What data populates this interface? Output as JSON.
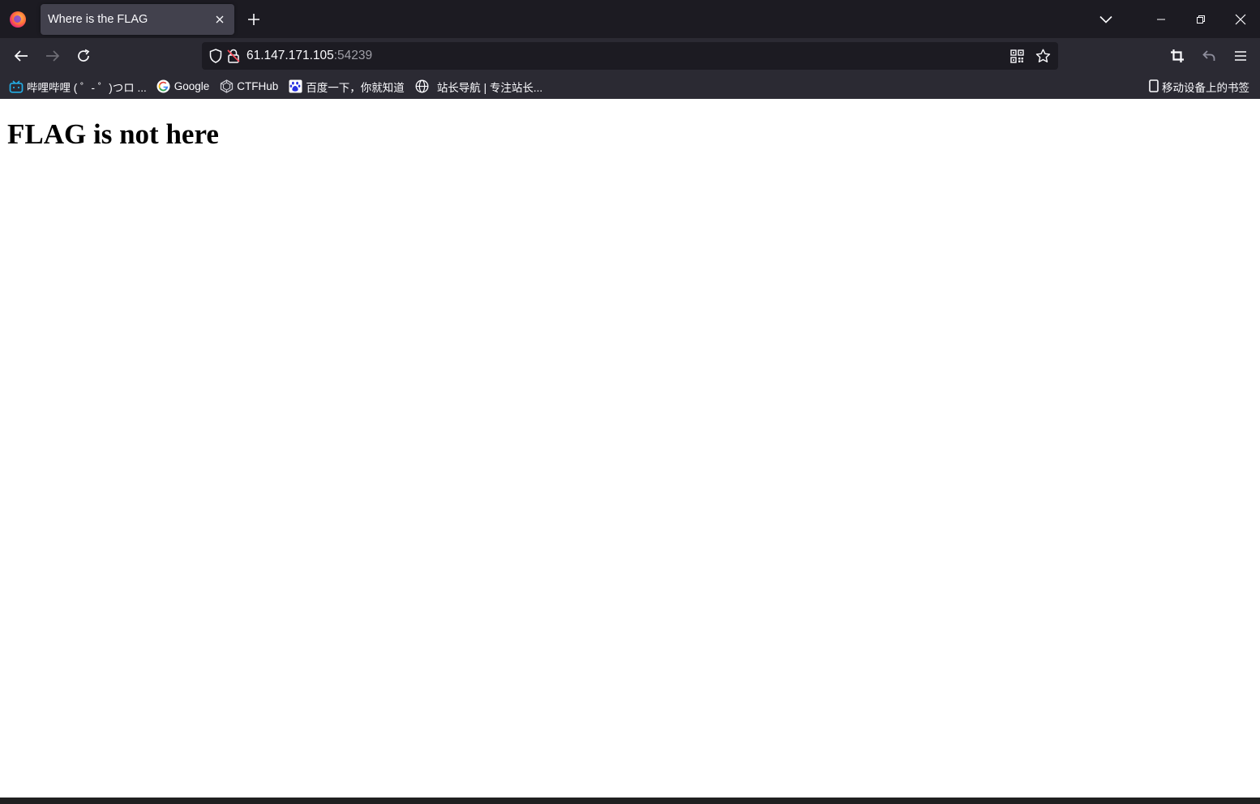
{
  "tabs": [
    {
      "title": "Where is the FLAG",
      "active": true
    }
  ],
  "urlbar": {
    "host": "61.147.171.105",
    "port": ":54239"
  },
  "bookmarks": [
    {
      "label": "哔哩哔哩 ( ゜- ゜)つロ ...",
      "icon": "bilibili-icon"
    },
    {
      "label": "Google",
      "icon": "google-icon"
    },
    {
      "label": "CTFHub",
      "icon": "ctfhub-icon"
    },
    {
      "label": "百度一下，你就知道",
      "icon": "baidu-icon"
    },
    {
      "label": "站长导航 | 专注站长...",
      "icon": "globe-icon"
    }
  ],
  "mobile_bookmarks": {
    "label": "移动设备上的书签",
    "icon": "mobile-icon"
  },
  "page": {
    "heading": "FLAG is not here"
  },
  "colors": {
    "tabstrip_bg": "#1c1b22",
    "toolbar_bg": "#2b2a33",
    "active_tab_bg": "#42414d",
    "text_light": "#fbfbfe",
    "page_bg": "#ffffff"
  }
}
